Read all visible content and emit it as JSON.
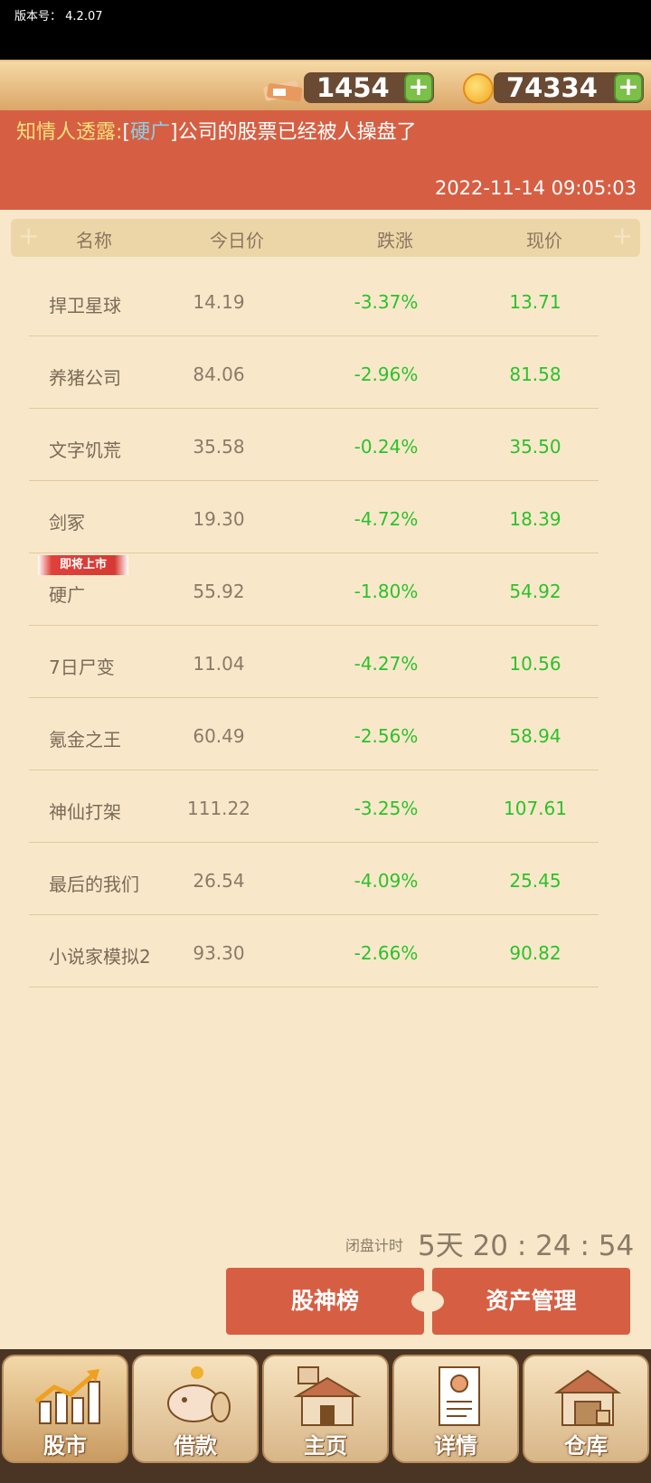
{
  "version": {
    "label": "版本号：",
    "value": "4.2.07"
  },
  "currency": {
    "money": "1454",
    "coins": "74334",
    "plus": "+"
  },
  "news": {
    "prefix": "知情人透露:",
    "bracket_open": "[",
    "company": "硬广",
    "bracket_close": "]",
    "message": "公司的股票已经被人操盘了",
    "time": "2022-11-14 09:05:03"
  },
  "table": {
    "headers": [
      "名称",
      "今日价",
      "跌涨",
      "现价"
    ],
    "rows": [
      {
        "name": "捍卫星球",
        "today": "14.19",
        "change": "-3.37%",
        "price": "13.71"
      },
      {
        "name": "养猪公司",
        "today": "84.06",
        "change": "-2.96%",
        "price": "81.58"
      },
      {
        "name": "文字饥荒",
        "today": "35.58",
        "change": "-0.24%",
        "price": "35.50"
      },
      {
        "name": "剑冢",
        "today": "19.30",
        "change": "-4.72%",
        "price": "18.39"
      },
      {
        "name": "硬广",
        "today": "55.92",
        "change": "-1.80%",
        "price": "54.92",
        "badge": "即将上市"
      },
      {
        "name": "7日尸变",
        "today": "11.04",
        "change": "-4.27%",
        "price": "10.56"
      },
      {
        "name": "氪金之王",
        "today": "60.49",
        "change": "-2.56%",
        "price": "58.94"
      },
      {
        "name": "神仙打架",
        "today": "111.22",
        "change": "-3.25%",
        "price": "107.61"
      },
      {
        "name": "最后的我们",
        "today": "26.54",
        "change": "-4.09%",
        "price": "25.45"
      },
      {
        "name": "小说家模拟2",
        "today": "93.30",
        "change": "-2.66%",
        "price": "90.82"
      }
    ]
  },
  "countdown": {
    "label": "闭盘计时",
    "value": "5天 20 : 24 : 54"
  },
  "actions": {
    "ranking": "股神榜",
    "assets": "资产管理"
  },
  "nav": [
    {
      "label": "股市",
      "icon": "stock-chart-icon"
    },
    {
      "label": "借款",
      "icon": "piggy-bank-icon"
    },
    {
      "label": "主页",
      "icon": "home-icon"
    },
    {
      "label": "详情",
      "icon": "profile-icon"
    },
    {
      "label": "仓库",
      "icon": "warehouse-icon"
    }
  ],
  "colors": {
    "banner": "#d65f43",
    "up_down_green": "#2cc12c",
    "background": "#f8e8c9"
  }
}
